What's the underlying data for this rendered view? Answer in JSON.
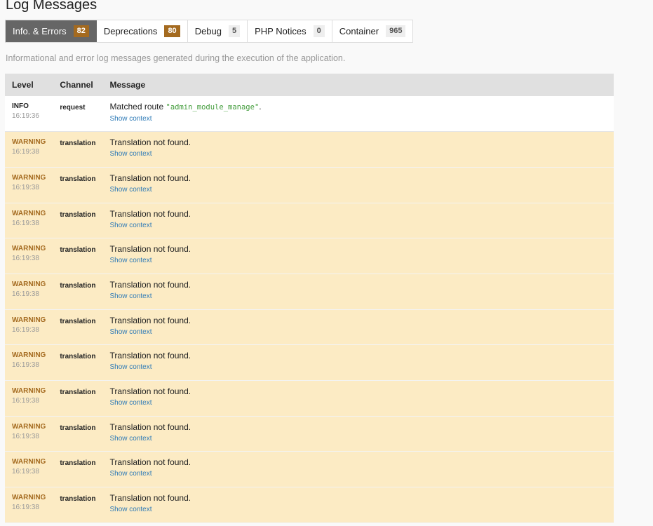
{
  "page_title": "Log Messages",
  "tabs": [
    {
      "label": "Info. & Errors",
      "count": "82"
    },
    {
      "label": "Deprecations",
      "count": "80"
    },
    {
      "label": "Debug",
      "count": "5"
    },
    {
      "label": "PHP Notices",
      "count": "0"
    },
    {
      "label": "Container",
      "count": "965"
    }
  ],
  "description": "Informational and error log messages generated during the execution of the application.",
  "table": {
    "headers": {
      "level": "Level",
      "channel": "Channel",
      "message": "Message"
    },
    "rows": [
      {
        "level": "INFO",
        "time": "16:19:36",
        "channel": "request",
        "message_prefix": "Matched route ",
        "message_code": "\"admin_module_manage\"",
        "message_suffix": ".",
        "link": "Show context"
      },
      {
        "level": "WARNING",
        "time": "16:19:38",
        "channel": "translation",
        "message": "Translation not found.",
        "link": "Show context"
      },
      {
        "level": "WARNING",
        "time": "16:19:38",
        "channel": "translation",
        "message": "Translation not found.",
        "link": "Show context"
      },
      {
        "level": "WARNING",
        "time": "16:19:38",
        "channel": "translation",
        "message": "Translation not found.",
        "link": "Show context"
      },
      {
        "level": "WARNING",
        "time": "16:19:38",
        "channel": "translation",
        "message": "Translation not found.",
        "link": "Show context"
      },
      {
        "level": "WARNING",
        "time": "16:19:38",
        "channel": "translation",
        "message": "Translation not found.",
        "link": "Show context"
      },
      {
        "level": "WARNING",
        "time": "16:19:38",
        "channel": "translation",
        "message": "Translation not found.",
        "link": "Show context"
      },
      {
        "level": "WARNING",
        "time": "16:19:38",
        "channel": "translation",
        "message": "Translation not found.",
        "link": "Show context"
      },
      {
        "level": "WARNING",
        "time": "16:19:38",
        "channel": "translation",
        "message": "Translation not found.",
        "link": "Show context"
      },
      {
        "level": "WARNING",
        "time": "16:19:38",
        "channel": "translation",
        "message": "Translation not found.",
        "link": "Show context"
      },
      {
        "level": "WARNING",
        "time": "16:19:38",
        "channel": "translation",
        "message": "Translation not found.",
        "link": "Show context"
      },
      {
        "level": "WARNING",
        "time": "16:19:38",
        "channel": "translation",
        "message": "Translation not found.",
        "link": "Show context"
      }
    ]
  },
  "colors": {
    "active_tab": "#666666",
    "warning_badge": "#a46a1f",
    "warning_row": "#fcebc4",
    "link": "#2f7bb7",
    "code": "#429c3b"
  }
}
